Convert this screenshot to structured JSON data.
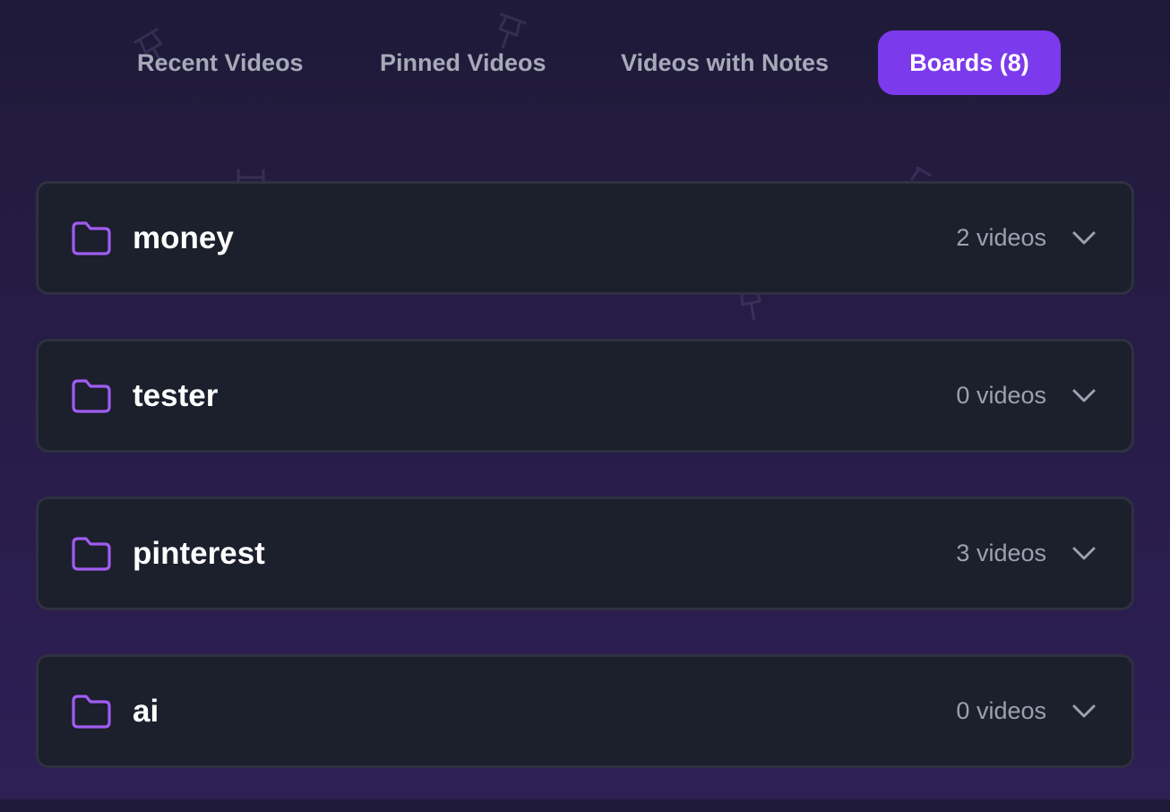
{
  "tabs": [
    {
      "label": "Recent Videos",
      "active": false
    },
    {
      "label": "Pinned Videos",
      "active": false
    },
    {
      "label": "Videos with Notes",
      "active": false
    },
    {
      "label": "Boards (8)",
      "active": true
    }
  ],
  "boards": [
    {
      "name": "money",
      "count": "2 videos",
      "icon": "folder-icon"
    },
    {
      "name": "tester",
      "count": "0 videos",
      "icon": "folder-icon"
    },
    {
      "name": "pinterest",
      "count": "3 videos",
      "icon": "folder-icon"
    },
    {
      "name": "ai",
      "count": "0 videos",
      "icon": "folder-icon"
    }
  ],
  "colors": {
    "accent": "#7c3aed",
    "folder_icon": "#a05cf2",
    "card_bg": "#1c1f2c",
    "card_border": "#2e3140",
    "muted_text": "#9da0ae"
  }
}
